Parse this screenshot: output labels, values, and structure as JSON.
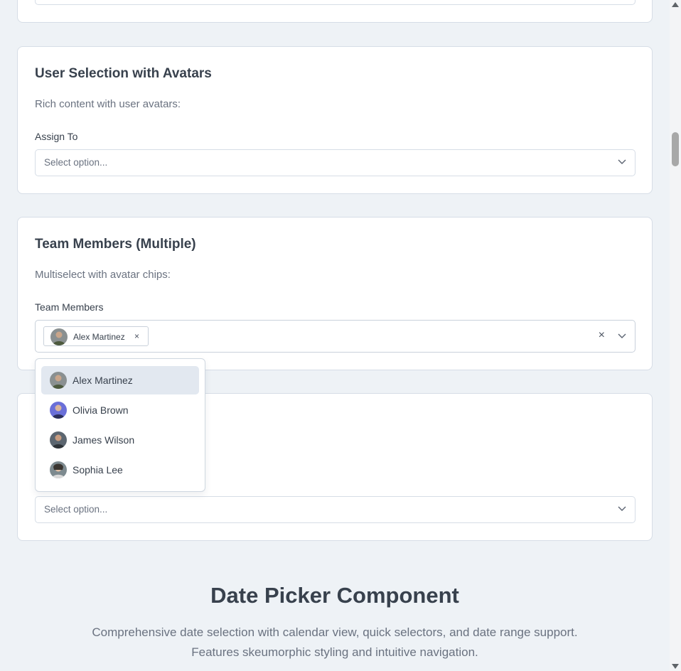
{
  "user_selection": {
    "title": "User Selection with Avatars",
    "description": "Rich content with user avatars:",
    "label": "Assign To",
    "placeholder": "Select option..."
  },
  "team_members": {
    "title": "Team Members (Multiple)",
    "description": "Multiselect with avatar chips:",
    "label": "Team Members",
    "selected_chips": [
      {
        "name": "Alex Martinez",
        "remove": "×"
      }
    ],
    "clear": "×",
    "options": [
      {
        "name": "Alex Martinez",
        "avatar": "alex-avatar"
      },
      {
        "name": "Olivia Brown",
        "avatar": "olivia-avatar"
      },
      {
        "name": "James Wilson",
        "avatar": "james-avatar"
      },
      {
        "name": "Sophia Lee",
        "avatar": "sophia-avatar"
      }
    ]
  },
  "third_card": {
    "placeholder": "Select option..."
  },
  "date_picker_section": {
    "title": "Date Picker Component",
    "description_line1": "Comprehensive date selection with calendar view, quick selectors, and date range support.",
    "description_line2": "Features skeumorphic styling and intuitive navigation."
  },
  "colors": {
    "page_bg": "#eef2f6",
    "card_bg": "#ffffff",
    "border": "#d6dde6",
    "active_option": "#e2e8f0",
    "text": "#38414d",
    "muted_text": "#6a7280"
  }
}
